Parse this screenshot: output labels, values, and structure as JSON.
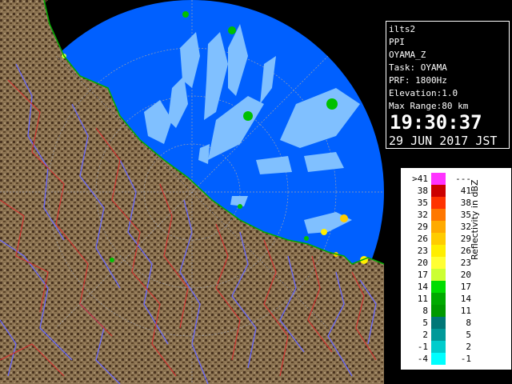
{
  "info": {
    "lines": [
      "ilts2",
      "PPI",
      "OYAMA_Z",
      "Task: OYAMA",
      "PRF: 1800Hz",
      "Elevation:1.0",
      "Max Range:80 km"
    ],
    "time": "19:30:37",
    "date": "29 JUN 2017 JST"
  },
  "legend": {
    "title": "Reflectivity in dBZ",
    "rows": [
      {
        "lo": ">41",
        "hi": "---",
        "color": "#ff33ff"
      },
      {
        "lo": "38",
        "hi": "41",
        "color": "#cc0000"
      },
      {
        "lo": "35",
        "hi": "38",
        "color": "#ff3300"
      },
      {
        "lo": "32",
        "hi": "35",
        "color": "#ff7700"
      },
      {
        "lo": "29",
        "hi": "32",
        "color": "#ffaa00"
      },
      {
        "lo": "26",
        "hi": "29",
        "color": "#ffcc00"
      },
      {
        "lo": "23",
        "hi": "26",
        "color": "#ffee00"
      },
      {
        "lo": "20",
        "hi": "23",
        "color": "#ffff33"
      },
      {
        "lo": "17",
        "hi": "20",
        "color": "#ccff33"
      },
      {
        "lo": "14",
        "hi": "17",
        "color": "#00dd00"
      },
      {
        "lo": "11",
        "hi": "14",
        "color": "#00aa00"
      },
      {
        "lo": "8",
        "hi": "11",
        "color": "#009900"
      },
      {
        "lo": "5",
        "hi": "8",
        "color": "#007777"
      },
      {
        "lo": "2",
        "hi": "5",
        "color": "#009999"
      },
      {
        "lo": "-1",
        "hi": "2",
        "color": "#00cccc"
      },
      {
        "lo": "-4",
        "hi": "-1",
        "color": "#00ffff"
      }
    ]
  },
  "colors": {
    "sea": "#0060ff",
    "outside": "#000000",
    "land": "#8a7250",
    "land_dark": "#4a3420",
    "river": "#6a6aff",
    "border": "#d83030",
    "echo_light": "#80c0ff",
    "echo_green": "#00c000"
  }
}
